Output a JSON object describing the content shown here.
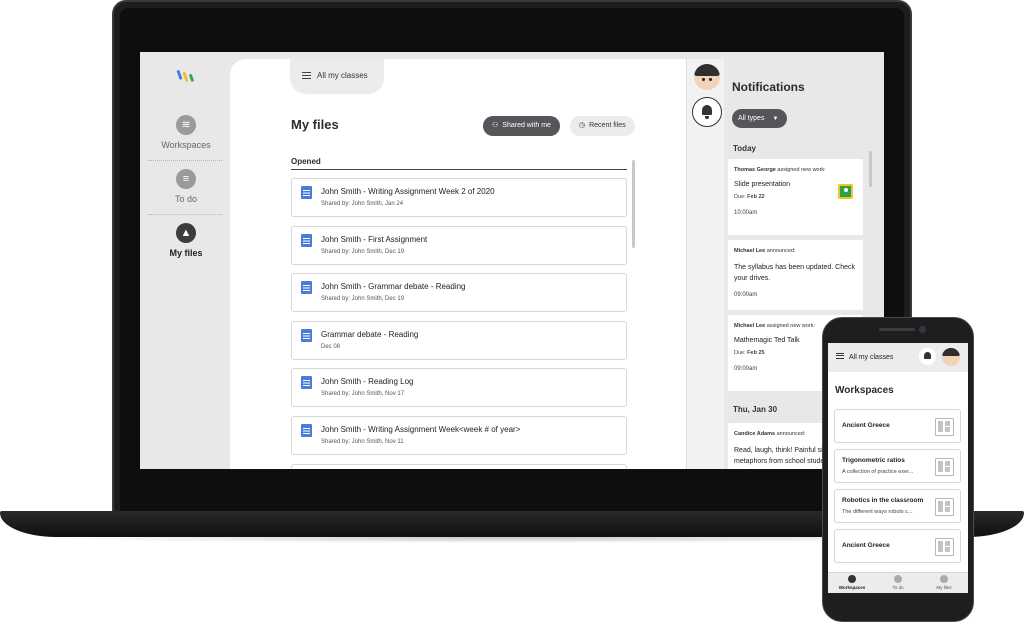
{
  "rail": {
    "items": [
      {
        "label": "Workspaces",
        "icon": "layers-icon"
      },
      {
        "label": "To do",
        "icon": "checklist-icon"
      },
      {
        "label": "My files",
        "icon": "drive-icon"
      }
    ]
  },
  "content": {
    "class_switch_label": "All my classes",
    "title": "My files",
    "filter_shared_label": "Shared with me",
    "filter_recent_label": "Recent files",
    "section_label": "Opened",
    "files": [
      {
        "name": "John Smith - Writing Assignment Week 2 of 2020",
        "meta": "Shared by: John Smith, Jan 24"
      },
      {
        "name": "John Smith - First Assignment",
        "meta": "Shared by: John Smith, Dec 19"
      },
      {
        "name": "John Smith - Grammar debate - Reading",
        "meta": "Shared by: John Smith, Dec 19"
      },
      {
        "name": "Grammar debate - Reading",
        "meta": "Dec 08"
      },
      {
        "name": "John Smith - Reading Log",
        "meta": "Shared by: John Smith, Nov 17"
      },
      {
        "name": "John Smith - Writing Assignment Week<week # of year>",
        "meta": "Shared by: John Smith, Nov 11"
      },
      {
        "name": "",
        "meta": ""
      }
    ]
  },
  "notifications": {
    "title": "Notifications",
    "type_filter": "All types",
    "days": [
      "Today",
      "Thu, Jan 30"
    ],
    "cards": [
      {
        "author": "Thomas George",
        "action": "assigned new work:",
        "title": "Slide presentation",
        "due_label": "Due:",
        "due": "Feb 22",
        "time": "10:00am"
      },
      {
        "author": "Michael Lee",
        "action": "announced:",
        "body": "The syllabus has been updated. Check your drives.",
        "time": "09:00am"
      },
      {
        "author": "Michael Lee",
        "action": "assigned new work:",
        "title": "Mathemagic Ted Talk",
        "due_label": "Due:",
        "due": "Feb 25",
        "time": "09:00am"
      },
      {
        "author": "Candice Adams",
        "action": "announced:",
        "body": "Read, laugh, think! Painful simile and metaphors from school student es..."
      }
    ]
  },
  "phone": {
    "menu_label": "All my classes",
    "title": "Workspaces",
    "workspaces": [
      {
        "name": "Ancient Greece",
        "desc": ""
      },
      {
        "name": "Trigonometric ratios",
        "desc": "A collection of practice exer..."
      },
      {
        "name": "Robotics in the classroom",
        "desc": "The different ways robots c..."
      },
      {
        "name": "Ancient Greece",
        "desc": ""
      }
    ],
    "tabs": [
      "Workspaces",
      "To do",
      "My files"
    ]
  },
  "colors": {
    "accent_dark": "#54565a",
    "doc_blue": "#4a7ddb",
    "classroom_green": "#2e9e4f"
  }
}
